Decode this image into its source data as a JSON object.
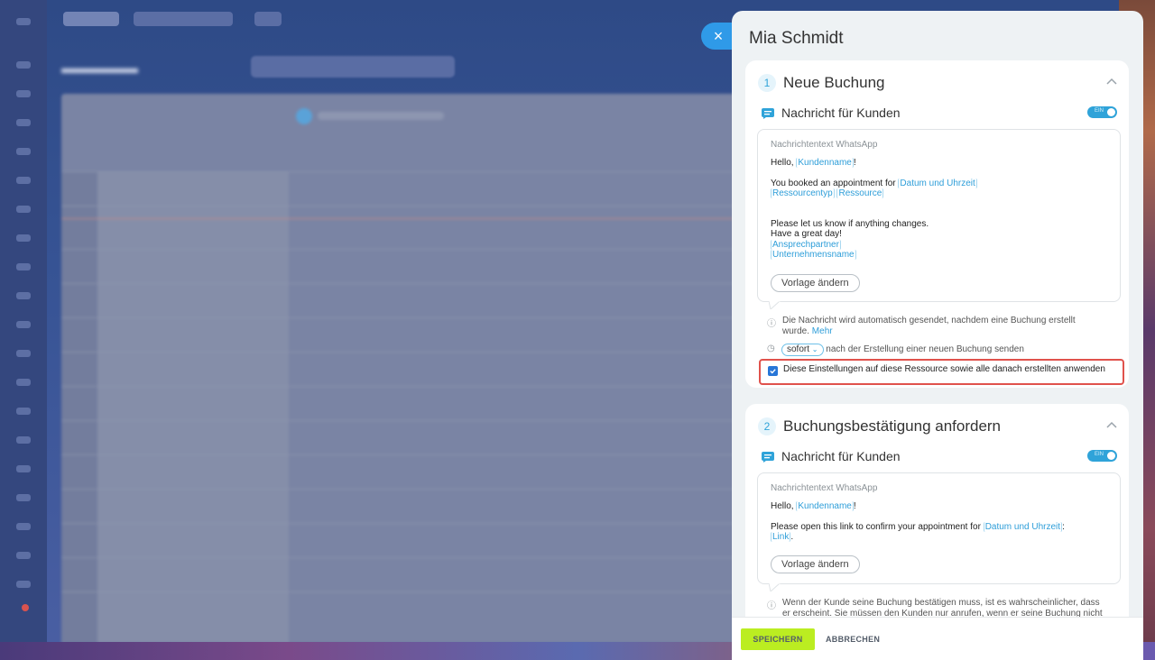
{
  "slider": {
    "title": "Mia Schmidt",
    "close_icon": "×"
  },
  "step1": {
    "number": "1",
    "title": "Neue Buchung",
    "message_label": "Nachricht für Kunden",
    "toggle_label": "EIN",
    "toggle_on": true,
    "box_kicker": "Nachrichtentext WhatsApp",
    "greeting": "Hello,",
    "tag_customer": "Kundenname",
    "exclaim": "!",
    "booked_text": "You booked an appointment for",
    "tag_datetime": "Datum und Uhrzeit",
    "tag_resource_type": "Ressourcentyp",
    "tag_resource": "Ressource",
    "line_changes": "Please let us know if anything changes.",
    "line_great_day": "Have a great day!",
    "tag_contact": "Ansprechpartner",
    "tag_company": "Unternehmensname",
    "template_button": "Vorlage ändern",
    "info_text_1": "Die Nachricht wird automatisch gesendet, nachdem eine Buchung erstellt",
    "info_text_2": "wurde.",
    "info_link": "Mehr",
    "timing_value": "sofort",
    "timing_text": "nach der Erstellung einer neuen Buchung senden",
    "apply_checkbox_label": "Diese Einstellungen auf diese Ressource sowie alle danach erstellten anwenden",
    "apply_checked": true
  },
  "step2": {
    "number": "2",
    "title": "Buchungsbestätigung anfordern",
    "message_label": "Nachricht für Kunden",
    "toggle_label": "EIN",
    "toggle_on": true,
    "box_kicker": "Nachrichtentext WhatsApp",
    "greeting": "Hello,",
    "tag_customer": "Kundenname",
    "exclaim": "!",
    "confirm_text": "Please open this link to confirm your appointment for",
    "tag_datetime": "Datum und Uhrzeit",
    "colon": ":",
    "tag_link": "Link",
    "period": ".",
    "template_button": "Vorlage ändern",
    "info_text_1": "Wenn der Kunde seine Buchung bestätigen muss, ist es wahrscheinlicher, dass",
    "info_text_2": "er erscheint. Sie müssen den Kunden nur anrufen, wenn er seine Buchung nicht"
  },
  "footer": {
    "save_label": "SPEICHERN",
    "cancel_label": "ABBRECHEN"
  },
  "colors": {
    "accent": "#2fa3d9",
    "save_button": "#bbed21",
    "highlight": "#e0524c",
    "checkbox": "#2776d7"
  },
  "icons": {
    "close": "close-icon",
    "chevron": "chevron-up-icon",
    "message": "chat-message-icon",
    "info": "info-icon",
    "clock": "clock-icon",
    "check": "check-icon"
  }
}
